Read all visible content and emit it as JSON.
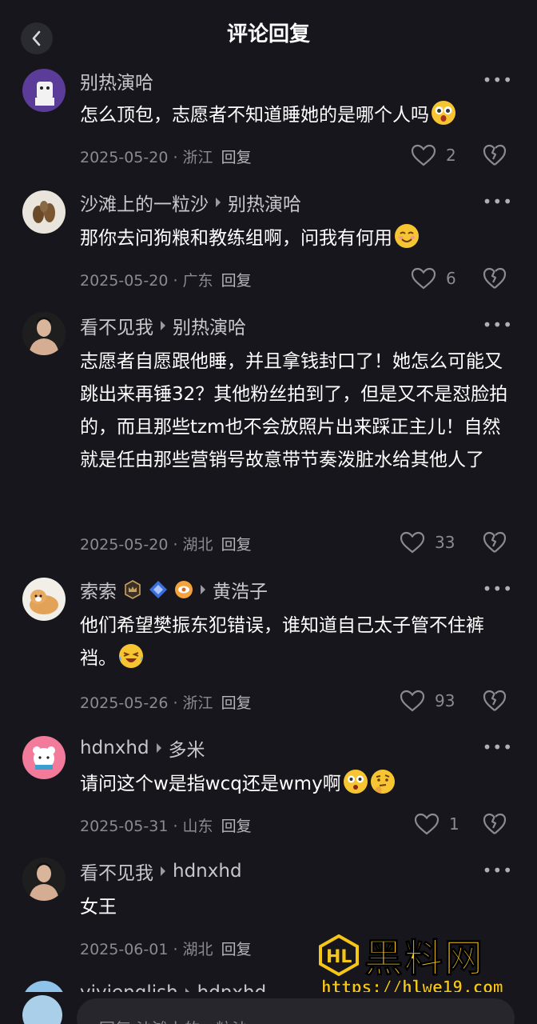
{
  "header": {
    "title": "评论回复"
  },
  "comments": [
    {
      "author": "别热演哈",
      "reply_to": "",
      "text": "怎么顶包，志愿者不知道睡她的是哪个人吗",
      "date": "2025-05-20",
      "location": "浙江",
      "reply_label": "回复",
      "likes": "2",
      "emoji": "starry-eyed-emoji"
    },
    {
      "author": "沙滩上的一粒沙",
      "reply_to": "别热演哈",
      "text": "那你去问狗粮和教练组啊，问我有何用",
      "date": "2025-05-20",
      "location": "广东",
      "reply_label": "回复",
      "likes": "6",
      "emoji": "smiling-emoji"
    },
    {
      "author": "看不见我",
      "reply_to": "别热演哈",
      "text": "志愿者自愿跟他睡，并且拿钱封口了！她怎么可能又跳出来再锤32？其他粉丝拍到了，但是又不是怼脸拍的，而且那些tzm也不会放照片出来踩正主儿！自然就是任由那些营销号故意带节奏泼脏水给其他人了",
      "date": "2025-05-20",
      "location": "湖北",
      "reply_label": "回复",
      "likes": "33"
    },
    {
      "author": "索索",
      "reply_to": "黄浩子",
      "text": "他们希望樊振东犯错误，谁知道自己太子管不住裤裆。",
      "date": "2025-05-26",
      "location": "浙江",
      "reply_label": "回复",
      "likes": "93",
      "emoji": "laughing-crying-emoji"
    },
    {
      "author": "hdnxhd",
      "reply_to": "多米",
      "text": "请问这个w是指wcq还是wmy啊",
      "date": "2025-05-31",
      "location": "山东",
      "reply_label": "回复",
      "likes": "1",
      "emoji": "thinking-emoji"
    },
    {
      "author": "看不见我",
      "reply_to": "hdnxhd",
      "text": "女王",
      "date": "2025-06-01",
      "location": "湖北",
      "reply_label": "回复",
      "likes": ""
    },
    {
      "author": "yiyienglish",
      "reply_to": "hdnxhd"
    }
  ],
  "bottom": {
    "placeholder": "回复 沙滩上的一粒沙"
  },
  "watermark": {
    "name": "黑料网",
    "url": "https://hlwe19.com"
  },
  "colors": {
    "background": "#16161c",
    "accent": "#f5c518",
    "muted": "#8a8a90"
  }
}
